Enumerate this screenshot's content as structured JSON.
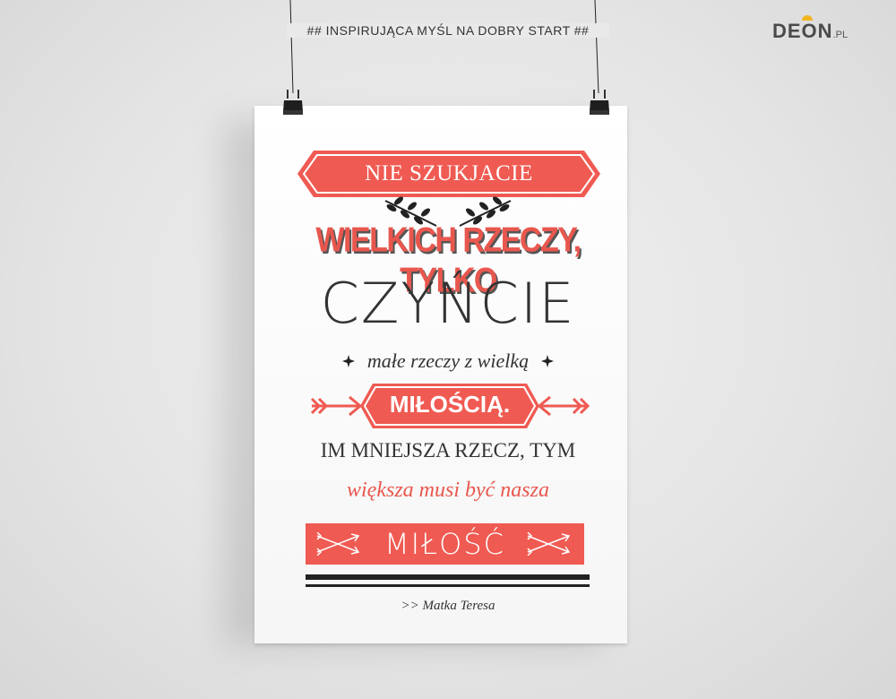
{
  "header": {
    "caption": "## INSPIRUJĄCA MYŚL NA DOBRY START ##"
  },
  "logo": {
    "brand": "DEON",
    "suffix": ".PL"
  },
  "poster": {
    "line1": "NIE SZUKJACIE",
    "line2": "WIELKICH RZECZY, TYLKO",
    "line3": "CZYŃCIE",
    "line4": "małe rzeczy z wielką",
    "line5": "MIŁOŚCIĄ.",
    "line6": "IM MNIEJSZA RZECZ, TYM",
    "line7": "większa musi być nasza",
    "line8": "MIŁOŚĆ",
    "author": ">> Matka Teresa"
  },
  "colors": {
    "accent": "#ef5a52",
    "text_dark": "#333333",
    "background": "#e4e4e4"
  },
  "icons": {
    "binder_clip": "binder-clip-icon",
    "laurel": "laurel-branch-icon",
    "star": "star-burst-icon",
    "arrow": "arrow-icon"
  }
}
